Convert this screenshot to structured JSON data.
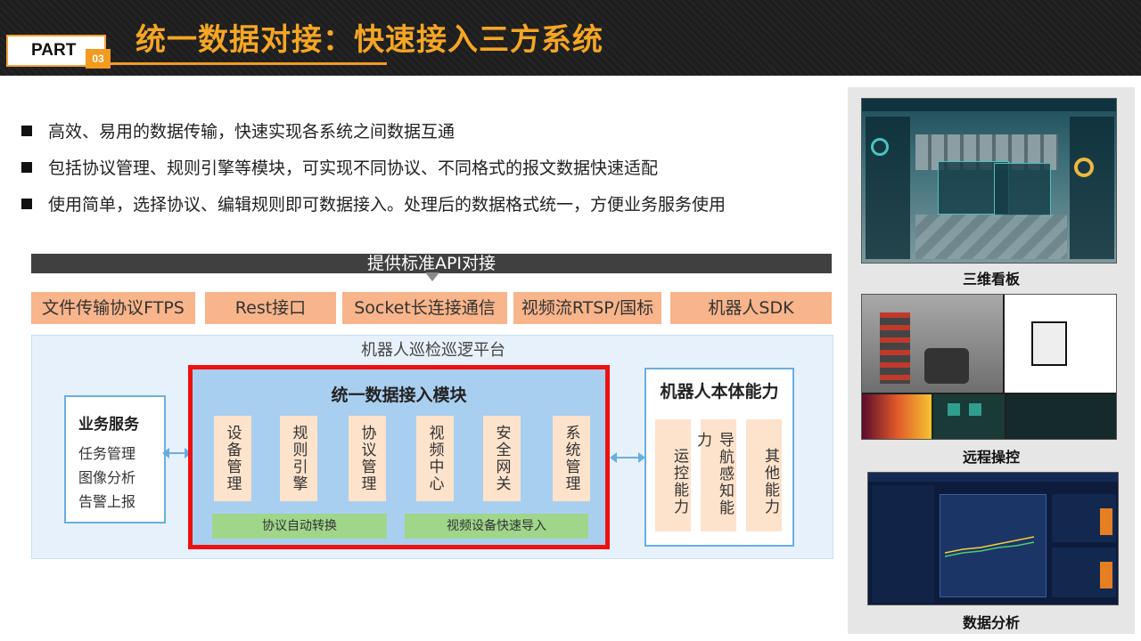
{
  "header": {
    "part_label": "PART",
    "part_number": "03",
    "title": "统一数据对接：快速接入三方系统"
  },
  "bullets": [
    "高效、易用的数据传输，快速实现各系统之间数据互通",
    "包括协议管理、规则引擎等模块，可实现不同协议、不同格式的报文数据快速适配",
    "使用简单，选择协议、编辑规则即可数据接入。处理后的数据格式统一，方便业务服务使用"
  ],
  "diagram": {
    "api_bar": "提供标准API对接",
    "protocols": [
      "文件传输协议FTPS",
      "Rest接口",
      "Socket长连接通信",
      "视频流RTSP/国标",
      "机器人SDK"
    ],
    "platform_title": "机器人巡检巡逻平台",
    "business": {
      "title": "业务服务",
      "items": [
        "任务管理",
        "图像分析",
        "告警上报"
      ]
    },
    "module": {
      "title": "统一数据接入模块",
      "items": [
        "设备管理",
        "规则引擎",
        "协议管理",
        "视频中心",
        "安全网关",
        "系统管理"
      ],
      "bottom": [
        "协议自动转换",
        "视频设备快速导入"
      ]
    },
    "robot": {
      "title": "机器人本体能力",
      "items": [
        "运控能力",
        "导航感知能力",
        "其他能力"
      ]
    }
  },
  "screenshots": [
    {
      "caption": "三维看板"
    },
    {
      "caption": "远程操控"
    },
    {
      "caption": "数据分析"
    }
  ],
  "colors": {
    "title_orange": "#f5a623",
    "module_border_red": "#ee1111",
    "protocol_fill": "#f8b48a",
    "sub_fill": "#fde3cc",
    "green_fill": "#9fd68a",
    "module_fill": "#a9cff0"
  }
}
